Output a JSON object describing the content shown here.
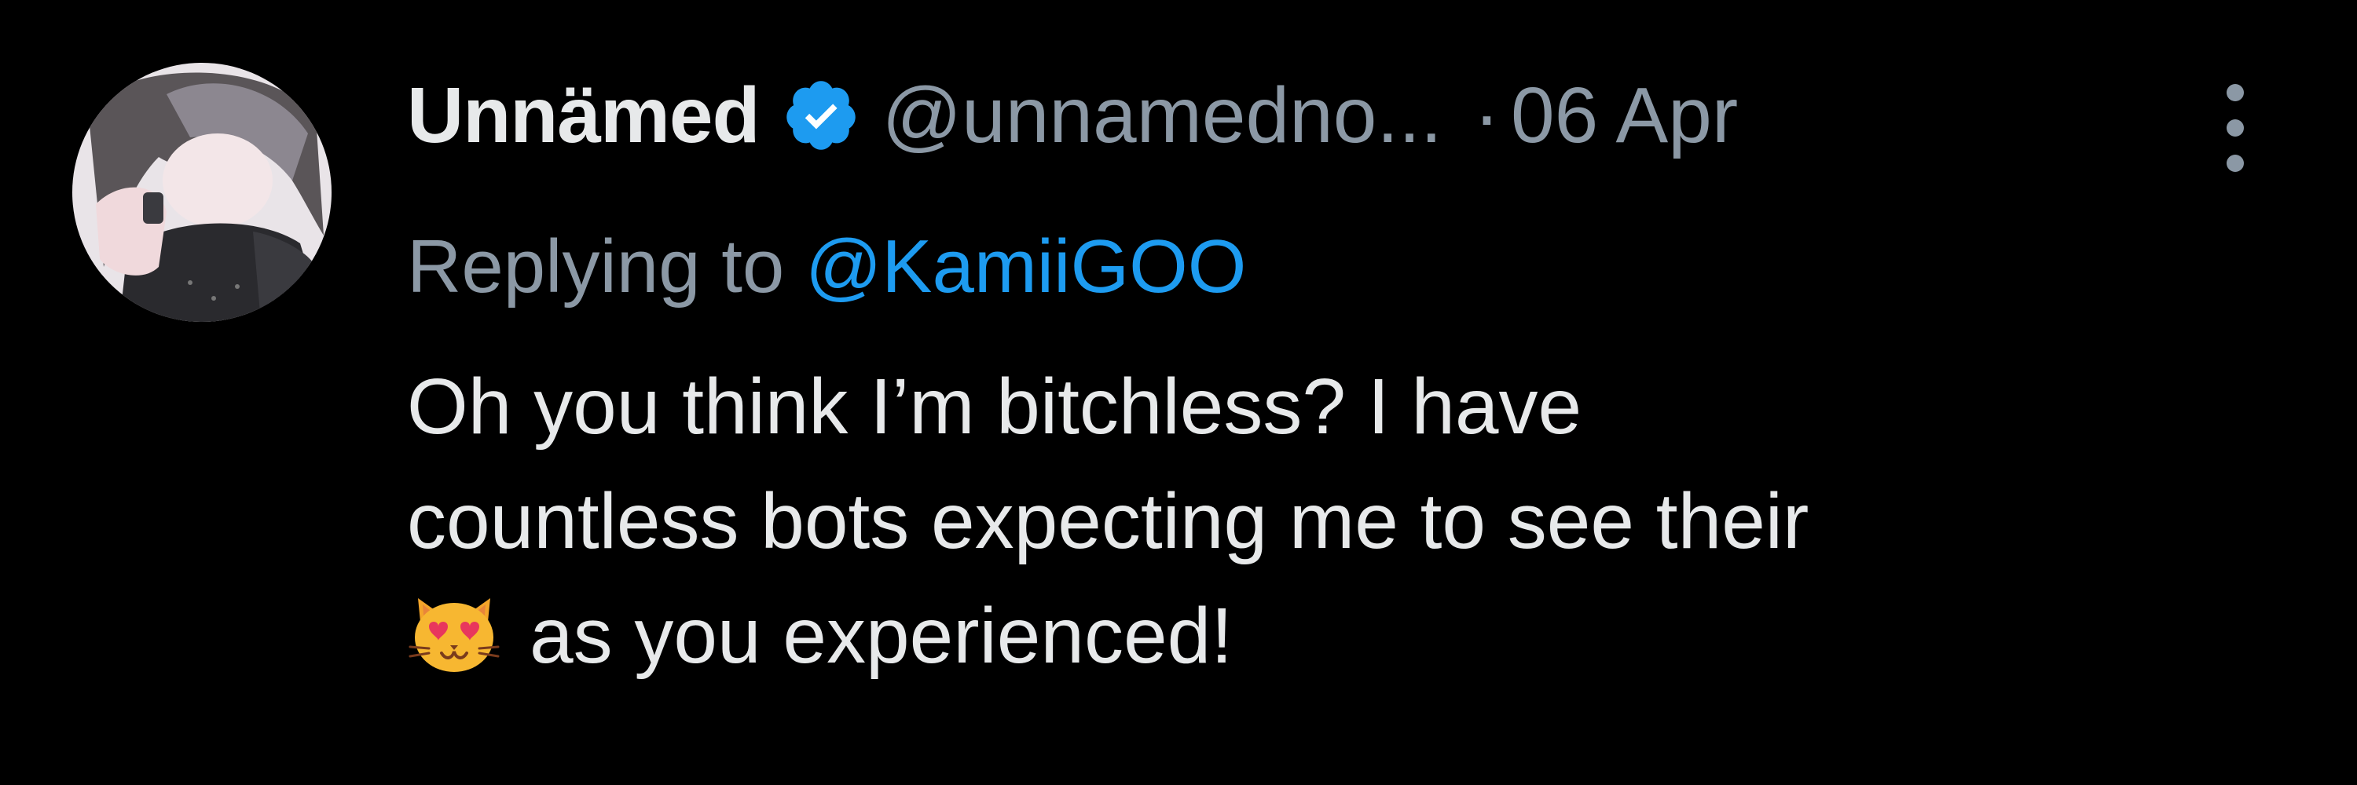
{
  "tweet": {
    "display_name": "Unnämed",
    "handle": "@unnamedno...",
    "separator": "·",
    "date": "06 Apr",
    "reply_prefix": "Replying to",
    "reply_handle": "@KamiiGOO",
    "text_lines": [
      "Oh you think I’m bitchless? I have",
      "countless bots expecting me to see their",
      "as you experienced!"
    ],
    "emoji": "smiling-cat-with-heart-eyes"
  },
  "icons": {
    "verified": "verified-badge-icon",
    "more": "more-options-icon"
  },
  "colors": {
    "background": "#000000",
    "primary_text": "#e7e9ea",
    "secondary_text": "#8b98a5",
    "link": "#1d9bf0",
    "verified_badge": "#1d9bf0"
  }
}
